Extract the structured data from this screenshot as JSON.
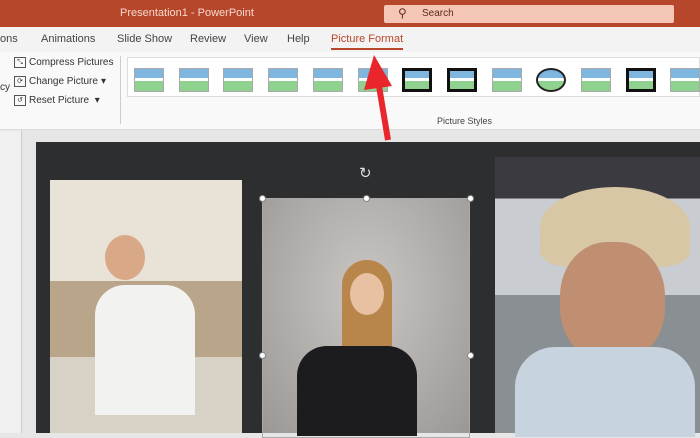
{
  "titlebar": {
    "title": "Presentation1  -  PowerPoint",
    "search_placeholder": "Search",
    "search_icon": "search-icon"
  },
  "tabs": [
    {
      "label": "ons"
    },
    {
      "label": "Animations"
    },
    {
      "label": "Slide Show"
    },
    {
      "label": "Review"
    },
    {
      "label": "View"
    },
    {
      "label": "Help"
    },
    {
      "label": "Picture Format",
      "active": true
    }
  ],
  "ribbon": {
    "adjust": {
      "partial_label": "cy",
      "compress": "Compress Pictures",
      "change": "Change Picture",
      "reset": "Reset Picture"
    },
    "styles_group_label": "Picture Styles",
    "style_count": 13
  },
  "colors": {
    "accent": "#b7472a",
    "slide_bg": "#2c2e30",
    "arrow": "#e8262b"
  }
}
